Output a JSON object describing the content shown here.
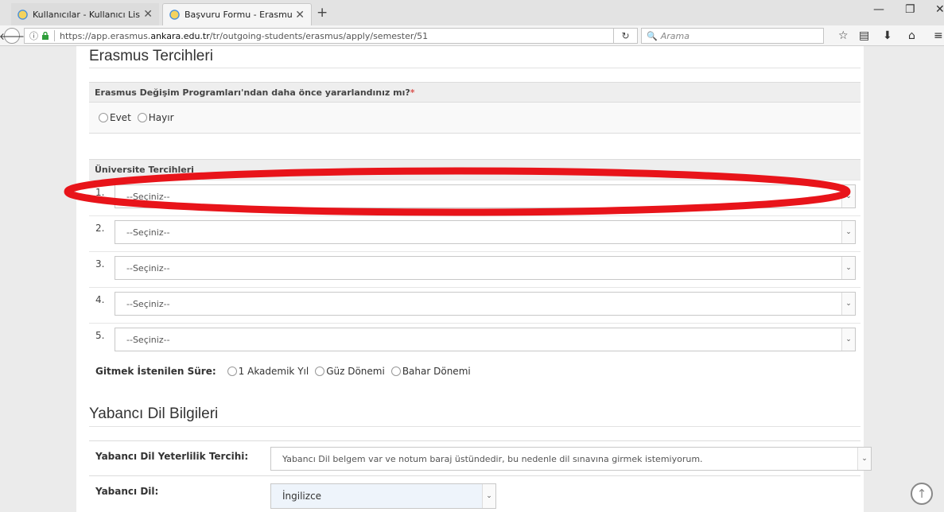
{
  "tabs": [
    {
      "title": "Kullanıcılar - Kullanıcı List...",
      "active": false
    },
    {
      "title": "Başvuru Formu - Erasmus...",
      "active": true
    }
  ],
  "icons": {
    "tab_close": "✕",
    "new_tab": "+",
    "back": "🡐",
    "info": "ⓘ",
    "reload": "↻",
    "search": "🔍",
    "bookmark_star": "☆",
    "reading_list": "▤",
    "download": "⬇",
    "home": "⌂",
    "menu": "≡",
    "minimize": "—",
    "restore": "❐",
    "close_window": "✕",
    "chevron_down": "⌄",
    "scroll_top": "↑"
  },
  "address_bar": {
    "url_prefix": "https://app.erasmus.",
    "url_domain": "ankara.edu.tr",
    "url_path": "/tr/outgoing-students/erasmus/apply/semester/51",
    "search_placeholder": "Arama"
  },
  "erasmus": {
    "section_title": "Erasmus Tercihleri",
    "question": "Erasmus Değişim Programları'ndan daha önce yararlandınız mı?",
    "required_mark": "*",
    "options": [
      "Evet",
      "Hayır"
    ]
  },
  "universities": {
    "heading": "Üniversite Tercihleri",
    "rows": [
      {
        "num": "1.",
        "value": "--Seçiniz--"
      },
      {
        "num": "2.",
        "value": "--Seçiniz--"
      },
      {
        "num": "3.",
        "value": "--Seçiniz--"
      },
      {
        "num": "4.",
        "value": "--Seçiniz--"
      },
      {
        "num": "5.",
        "value": "--Seçiniz--"
      }
    ]
  },
  "duration": {
    "label": "Gitmek İstenilen Süre:",
    "options": [
      "1 Akademik Yıl",
      "Güz Dönemi",
      "Bahar Dönemi"
    ]
  },
  "language": {
    "section_title": "Yabancı Dil Bilgileri",
    "proficiency_label": "Yabancı Dil Yeterlilik Tercihi:",
    "proficiency_value": "Yabancı Dil belgem var ve notum baraj üstündedir, bu nedenle dil sınavına girmek istemiyorum.",
    "language_label": "Yabancı Dil:",
    "language_value": "İngilizce"
  },
  "colors": {
    "annotation": "#e8141a",
    "required": "#d9534f"
  }
}
